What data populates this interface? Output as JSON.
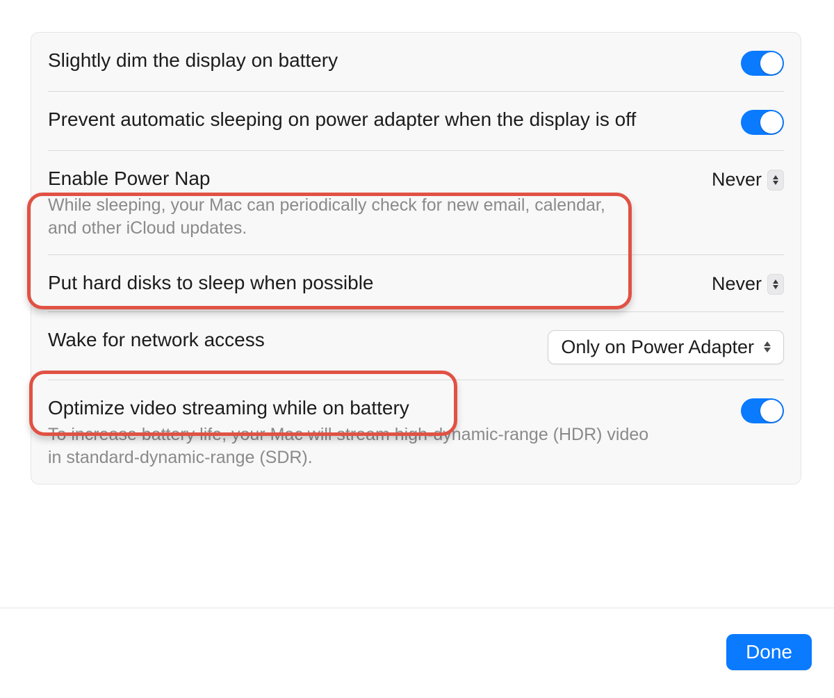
{
  "settings": {
    "dim_display": {
      "title": "Slightly dim the display on battery",
      "on": true
    },
    "prevent_sleep": {
      "title": "Prevent automatic sleeping on power adapter when the display is off",
      "on": true
    },
    "power_nap": {
      "title": "Enable Power Nap",
      "subtitle": "While sleeping, your Mac can periodically check for new email, calendar, and other iCloud updates.",
      "value": "Never"
    },
    "hard_disks": {
      "title": "Put hard disks to sleep when possible",
      "value": "Never"
    },
    "wake_network": {
      "title": "Wake for network access",
      "value": "Only on Power Adapter"
    },
    "optimize_video": {
      "title": "Optimize video streaming while on battery",
      "subtitle": "To increase battery life, your Mac will stream high-dynamic-range (HDR) video in standard-dynamic-range (SDR).",
      "on": true
    }
  },
  "footer": {
    "done_label": "Done"
  }
}
